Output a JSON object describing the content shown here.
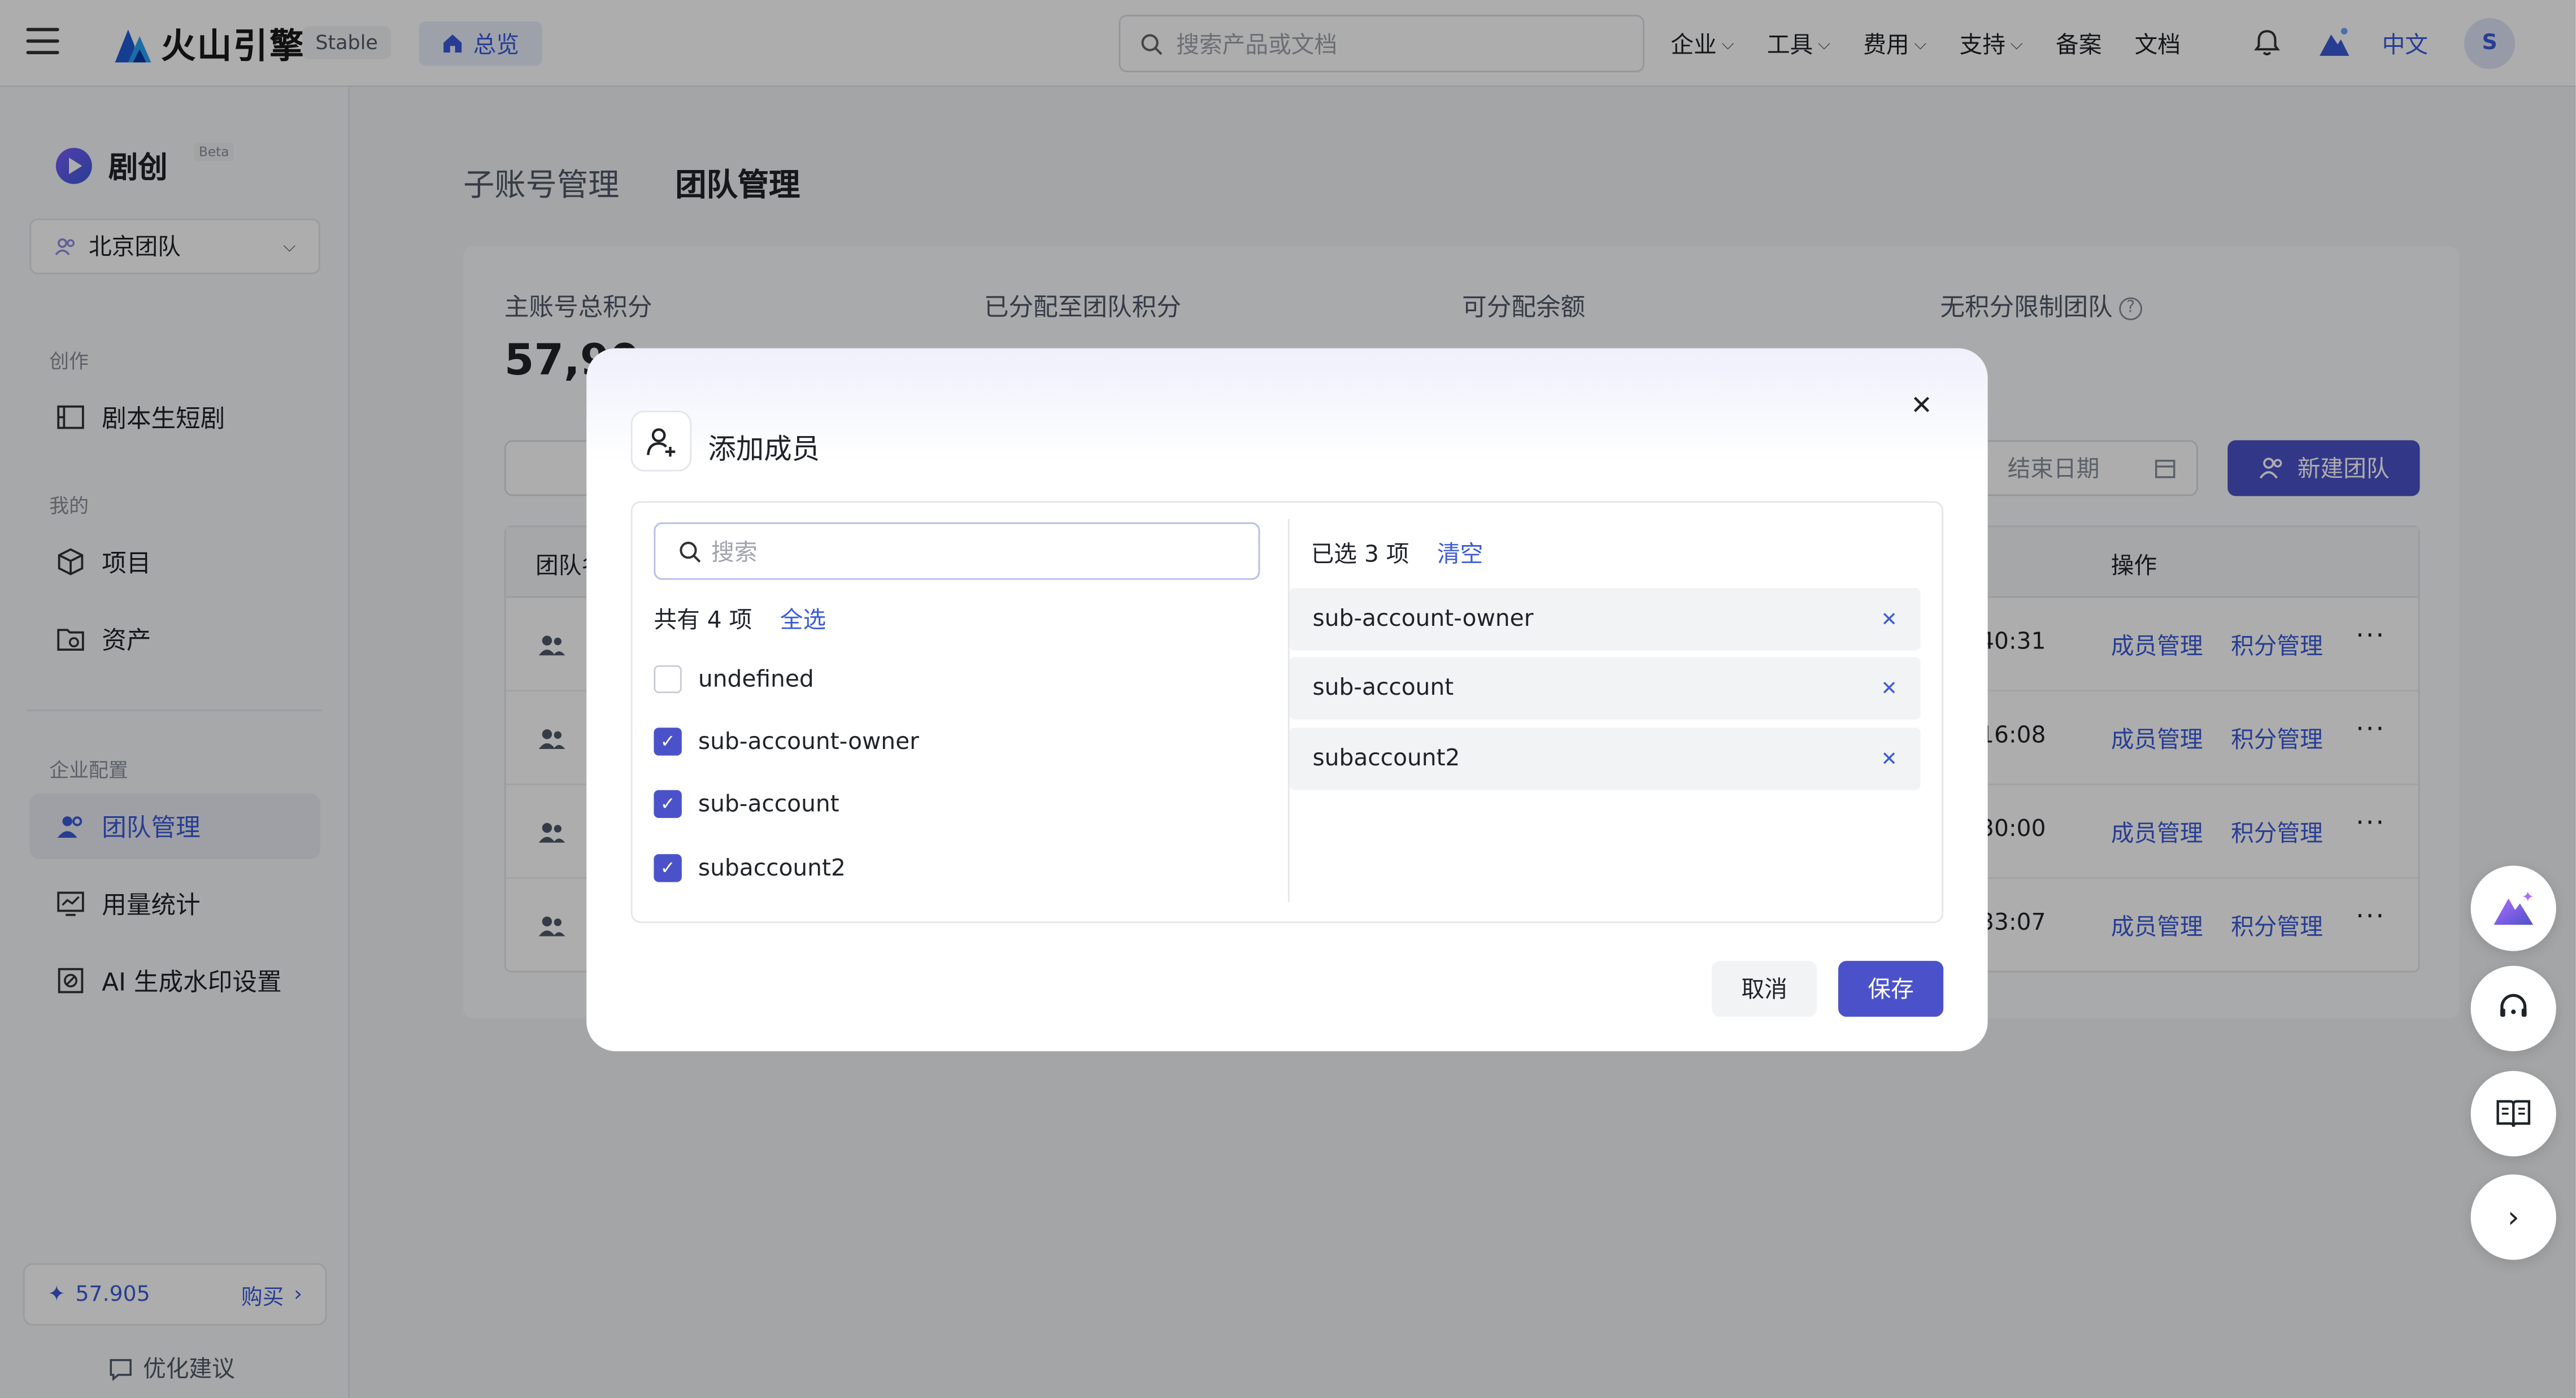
{
  "topbar": {
    "logo_text": "火山引擎",
    "stable_label": "Stable",
    "home_tab": "总览",
    "search_placeholder": "搜索产品或文档",
    "nav": [
      "企业",
      "工具",
      "费用",
      "支持",
      "备案",
      "文档"
    ],
    "lang": "中文",
    "avatar": "S"
  },
  "sidebar": {
    "brand": "剧创",
    "beta": "Beta",
    "team": "北京团队",
    "section_create": "创作",
    "item_script": "剧本生短剧",
    "section_mine": "我的",
    "item_project": "项目",
    "item_assets": "资产",
    "section_enterprise": "企业配置",
    "item_team": "团队管理",
    "item_usage": "用量统计",
    "item_watermark": "AI 生成水印设置",
    "credits": "57.905",
    "buy": "购买",
    "suggest": "优化建议"
  },
  "main": {
    "tab_sub": "子账号管理",
    "tab_team": "团队管理",
    "stat_total": "主账号总积分",
    "stat_assigned": "已分配至团队积分",
    "stat_available": "可分配余额",
    "stat_unlimited": "无积分限制团队",
    "total_value": "57,90",
    "end_date_placeholder": "结束日期",
    "new_team": "新建团队",
    "col_team": "团队名",
    "col_ops": "操作",
    "rows": [
      {
        "time": "40:31",
        "member": "成员管理",
        "points": "积分管理"
      },
      {
        "time": "16:08",
        "member": "成员管理",
        "points": "积分管理"
      },
      {
        "time": "30:00",
        "member": "成员管理",
        "points": "积分管理"
      },
      {
        "time": "33:07",
        "member": "成员管理",
        "points": "积分管理"
      }
    ]
  },
  "modal": {
    "title": "添加成员",
    "search_placeholder": "搜索",
    "total_label": "共有 4 项",
    "select_all": "全选",
    "options": [
      {
        "label": "undefined",
        "checked": false
      },
      {
        "label": "sub-account-owner",
        "checked": true
      },
      {
        "label": "sub-account",
        "checked": true
      },
      {
        "label": "subaccount2",
        "checked": true
      }
    ],
    "selected_label": "已选 3 项",
    "clear": "清空",
    "selected": [
      "sub-account-owner",
      "sub-account",
      "subaccount2"
    ],
    "cancel": "取消",
    "save": "保存"
  },
  "colors": {
    "accent": "#4b52c9",
    "link": "#3c5bd8"
  }
}
